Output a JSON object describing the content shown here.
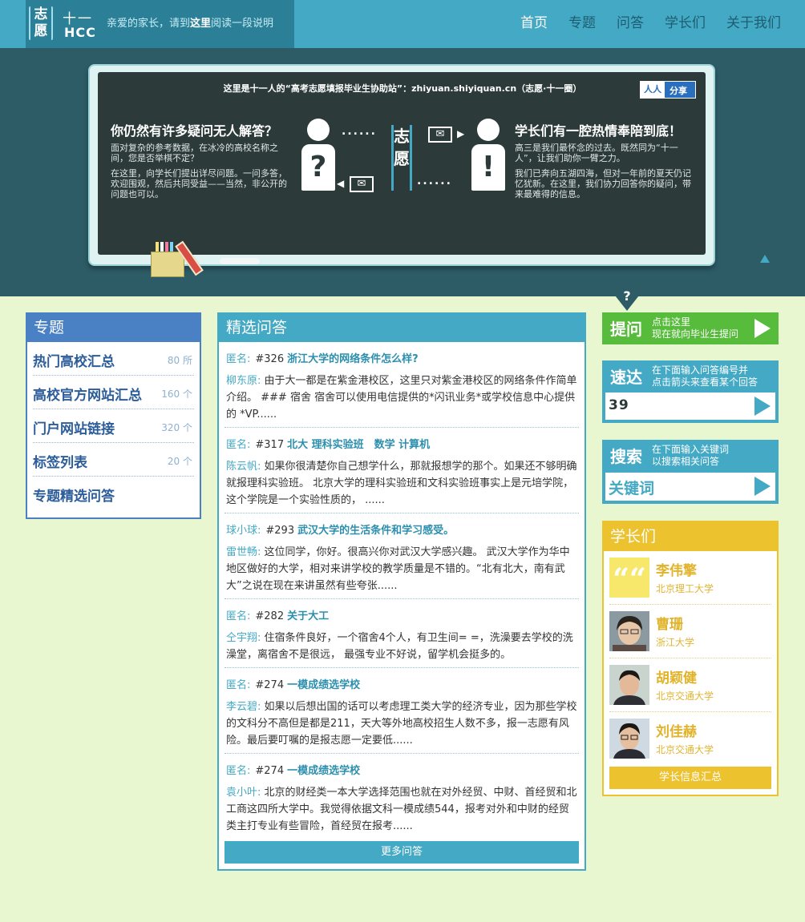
{
  "header": {
    "logo": {
      "zy_line1": "志",
      "zy_line2": "愿",
      "num": "十一",
      "hcc": "HCC"
    },
    "notice": {
      "pre": "亲爱的家长，请到",
      "link": "这里",
      "post": "阅读一段说明"
    },
    "nav": [
      "首页",
      "专题",
      "问答",
      "学长们",
      "关于我们"
    ]
  },
  "hero": {
    "title": "这里是十一人的“高考志愿填报毕业生协助站”：zhiyuan.shiyiquan.cn（志愿·十一圈）",
    "share": {
      "logo": "人人",
      "label": "分享"
    },
    "left": {
      "heading": "你仍然有许多疑问无人解答？",
      "p1": "面对复杂的参考数据，在冰冷的高校名称之间，您是否举棋不定？",
      "p2": "在这里，向学长们提出详尽问题。一问多答，欢迎围观，然后共同受益——当然，非公开的问题也可以。"
    },
    "right": {
      "heading": "学长们有一腔热情奉陪到底！",
      "p1": "高三是我们最怀念的过去。既然同为“十一人”，让我们助你一臂之力。",
      "p2": "我们已奔向五湖四海，但对一年前的夏天仍记忆犹新。在这里，我们协力回答你的疑问，带来最难得的信息。"
    },
    "center": {
      "zy1": "志",
      "zy2": "愿",
      "q_mark": "?",
      "excl_mark": "!"
    },
    "pointer_mark": "?"
  },
  "topics": {
    "title": "专题",
    "items": [
      {
        "label": "热门高校汇总",
        "count": "80 所"
      },
      {
        "label": "高校官方网站汇总",
        "count": "160 个"
      },
      {
        "label": "门户网站链接",
        "count": "320 个"
      },
      {
        "label": "标签列表",
        "count": "20 个"
      },
      {
        "label": "专题精选问答",
        "count": ""
      }
    ]
  },
  "qa": {
    "title": "精选问答",
    "items": [
      {
        "asker": "匿名:",
        "num": "#326",
        "title": "浙江大学的网络条件怎么样?",
        "author": "柳东原:",
        "answer": "由于大一都是在紫金港校区，这里只对紫金港校区的网络条件作简单介绍。 ### 宿舍 宿舍可以使用电信提供的*闪讯业务*或学校信息中心提供的 *VP......"
      },
      {
        "asker": "匿名:",
        "num": "#317",
        "title": "北大 理科实验班　数学 计算机",
        "author": "陈云帆:",
        "answer": "如果你很清楚你自己想学什么，那就报想学的那个。如果还不够明确就报理科实验班。 北京大学的理科实验班和文科实验班事实上是元培学院，这个学院是一个实验性质的， ......"
      },
      {
        "asker": "球小球:",
        "num": "#293",
        "title": "武汉大学的生活条件和学习感受。",
        "author": "雷世畅:",
        "answer": "这位同学，你好。很高兴你对武汉大学感兴趣。 武汉大学作为华中地区做好的大学，相对来讲学校的教学质量是不错的。“北有北大，南有武大”之说在现在来讲虽然有些夸张......"
      },
      {
        "asker": "匿名:",
        "num": "#282",
        "title": "关于大工",
        "author": "仝宇翔:",
        "answer": "住宿条件良好，一个宿舍4个人，有卫生间= =，洗澡要去学校的洗澡堂，离宿舍不是很远， 最强专业不好说，留学机会挺多的。"
      },
      {
        "asker": "匿名:",
        "num": "#274",
        "title": "一模成绩选学校",
        "author": "李云碧:",
        "answer": "如果以后想出国的话可以考虑理工类大学的经济专业，因为那些学校的文科分不高但是都是211，天大等外地高校招生人数不多，报一志愿有风险。最后要叮嘱的是报志愿一定要低......"
      },
      {
        "asker": "匿名:",
        "num": "#274",
        "title": "一模成绩选学校",
        "author": "袁小叶:",
        "answer": "北京的财经类一本大学选择范围也就在对外经贸、中财、首经贸和北工商这四所大学中。我觉得依据文科一模成绩544，报考对外和中财的经贸类主打专业有些冒险，首经贸在报考......"
      }
    ],
    "more": "更多问答"
  },
  "ask": {
    "big": "提问",
    "line1": "点击这里",
    "line2": "现在就向毕业生提问"
  },
  "quick": {
    "big": "速达",
    "line1": "在下面输入问答编号并",
    "line2": "点击箭头来查看某个回答",
    "value": "39"
  },
  "search": {
    "big": "搜索",
    "line1": "在下面输入关键词",
    "line2": "以搜索相关问答",
    "placeholder": "关键词"
  },
  "seniors": {
    "title": "学长们",
    "items": [
      {
        "name": "李伟擎",
        "school": "北京理工大学",
        "avatar": "quote-avatar",
        "quote_mark": "““"
      },
      {
        "name": "曹珊",
        "school": "浙江大学",
        "avatar": "photo"
      },
      {
        "name": "胡颖健",
        "school": "北京交通大学",
        "avatar": "photo"
      },
      {
        "name": "刘佳赫",
        "school": "北京交通大学",
        "avatar": "photo"
      }
    ],
    "button": "学长信息汇总"
  }
}
